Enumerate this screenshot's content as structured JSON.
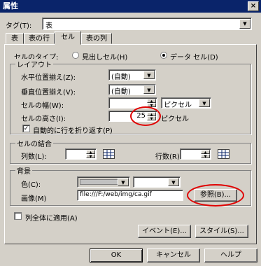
{
  "window": {
    "title": "属性",
    "close": "×"
  },
  "tag": {
    "label": "タグ(T):",
    "value": "表"
  },
  "tabs": [
    "表",
    "表の行",
    "セル",
    "表の列"
  ],
  "cell_type": {
    "label": "セルのタイプ:",
    "opt_header": "見出しセル(H)",
    "opt_data": "データ セル(D)",
    "selected": "data"
  },
  "layout": {
    "legend": "レイアウト",
    "halign_label": "水平位置揃え(Z):",
    "halign_value": "(自動)",
    "valign_label": "垂直位置揃え(V):",
    "valign_value": "(自動)",
    "width_label": "セルの幅(W):",
    "width_value": "",
    "width_unit": "ピクセル",
    "height_label": "セルの高さ(I):",
    "height_value": "25",
    "height_unit": "ピクセル",
    "wrap_label": "自動的に行を折り返す(P)",
    "wrap_checked": true
  },
  "merge": {
    "legend": "セルの結合",
    "cols_label": "列数(L):",
    "cols_value": "",
    "rows_label": "行数(R):",
    "rows_value": ""
  },
  "background": {
    "legend": "背景",
    "color_label": "色(C):",
    "image_label": "画像(M)",
    "image_value": "file:///F:/web/img/ca.gif",
    "browse": "参照(B)..."
  },
  "apply_column": {
    "label": "列全体に適用(A)",
    "checked": false
  },
  "buttons": {
    "event": "イベント(E)...",
    "style": "スタイル(S)...",
    "ok": "OK",
    "cancel": "キャンセル",
    "help": "ヘルプ"
  }
}
